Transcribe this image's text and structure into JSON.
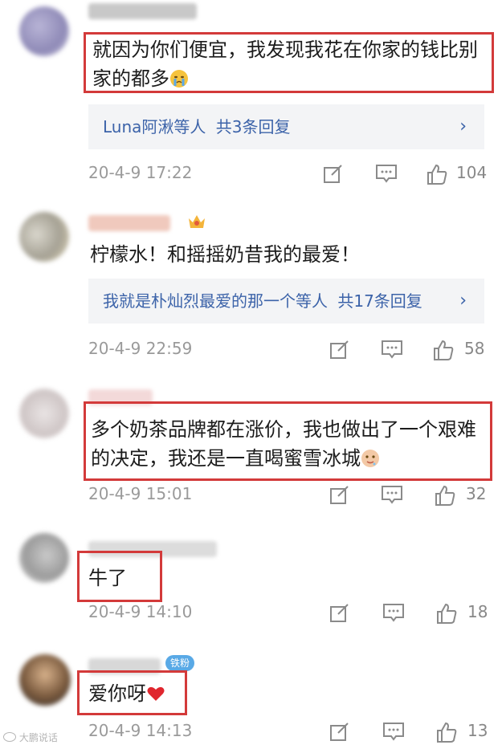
{
  "comments": [
    {
      "text": "就因为你们便宜，我发现我花在你家的钱比别家的都多",
      "reply_names": "Luna阿湫等人",
      "reply_count": "共3条回复",
      "time": "20-4-9 17:22",
      "likes": "104",
      "emoji": "crying-face-icon"
    },
    {
      "text": "柠檬水！和摇摇奶昔我的最爱！",
      "reply_names": "我就是朴灿烈最爱的那一个等人",
      "reply_count": "共17条回复",
      "time": "20-4-9 22:59",
      "likes": "58"
    },
    {
      "text": "多个奶茶品牌都在涨价，我也做出了一个艰难的决定，我还是一直喝蜜雪冰城",
      "time": "20-4-9 15:01",
      "likes": "32",
      "emoji": "drooling-face-icon"
    },
    {
      "text": "牛了",
      "time": "20-4-9 14:10",
      "likes": "18"
    },
    {
      "text": "爱你呀",
      "time": "20-4-9 14:13",
      "likes": "13",
      "badge": "铁粉",
      "emoji": "red-heart-icon"
    }
  ],
  "colors": {
    "highlight_border": "#d33a3a",
    "reply_link": "#3c63a9",
    "meta_gray": "#9a9a9a",
    "reply_bg": "#f3f4f6"
  },
  "watermark": "大鹏说话"
}
